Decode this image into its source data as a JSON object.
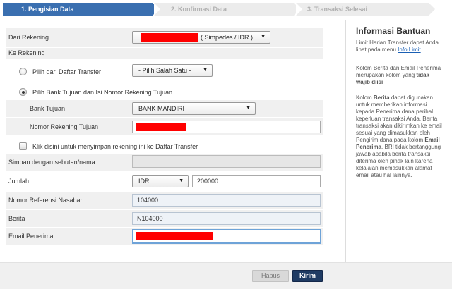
{
  "steps": [
    {
      "label": "1. Pengisian Data"
    },
    {
      "label": "2. Konfirmasi Data"
    },
    {
      "label": "3. Transaksi Selesai"
    }
  ],
  "form": {
    "dari_rekening": {
      "label": "Dari Rekening",
      "account_suffix": "( Simpedes / IDR )"
    },
    "ke_rekening": {
      "label": "Ke Rekening"
    },
    "pilih_daftar": {
      "label": "Pilih dari Daftar Transfer",
      "select_value": "- Pilih Salah Satu -",
      "selected": false
    },
    "pilih_bank": {
      "label": "Pilih Bank Tujuan dan Isi Nomor Rekening Tujuan",
      "selected": true
    },
    "bank_tujuan": {
      "label": "Bank Tujuan",
      "value": "BANK MANDIRI"
    },
    "nomor_rekening_tujuan": {
      "label": "Nomor Rekening Tujuan"
    },
    "simpan": {
      "label": "Klik disini untuk menyimpan rekening ini ke Daftar Transfer",
      "checked": false
    },
    "simpan_nama": {
      "label": "Simpan dengan sebutan/nama",
      "value": ""
    },
    "jumlah": {
      "label": "Jumlah",
      "currency": "IDR",
      "value": "200000"
    },
    "nomor_referensi": {
      "label": "Nomor Referensi Nasabah",
      "value": "104000"
    },
    "berita": {
      "label": "Berita",
      "value": "N104000"
    },
    "email": {
      "label": "Email Penerima"
    }
  },
  "side": {
    "title": "Informasi Bantuan",
    "p1_text": "Limit Harian Transfer dapat Anda lihat pada menu",
    "p1_link": "Info Limit",
    "p2_text": "Kolom Berita dan Email Penerima merupakan kolom yang",
    "p2_bold": "tidak wajib diisi",
    "p3_a": "Kolom",
    "p3_b1": "Berita",
    "p3_c": "dapat digunakan untuk memberikan informasi kepada Penerima dana perihal keperluan transaksi Anda. Berita transaksi akan dikirimkan ke email sesuai yang dimasukkan oleh Pengirim dana pada kolom",
    "p3_b2": "Email Penerima",
    "p3_d": ". BRI tidak bertanggung jawab apabila berita transaksi diterima oleh pihak lain karena kelalaian memasukkan alamat email atau hal lainnya."
  },
  "buttons": {
    "hapus": "Hapus",
    "kirim": "Kirim"
  },
  "colors": {
    "accent": "#3a6fb0",
    "primary_button": "#1f3b63",
    "redaction": "#ff0000",
    "link": "#1a5fb4"
  },
  "icons": {
    "dropdown": "caret-down-icon"
  }
}
